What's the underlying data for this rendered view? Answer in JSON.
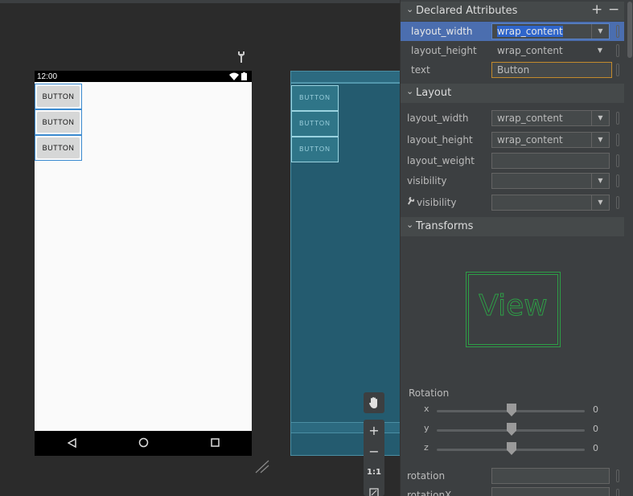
{
  "phone": {
    "time": "12:00",
    "buttons": [
      "BUTTON",
      "BUTTON",
      "BUTTON"
    ]
  },
  "blueprint": {
    "buttons": [
      "BUTTON",
      "BUTTON",
      "BUTTON"
    ]
  },
  "zoom_tools": {
    "pan_icon": "hand-icon",
    "zoom_in": "+",
    "zoom_out": "−",
    "actual_size": "1:1",
    "fit_icon": "fit-screen-icon"
  },
  "declared": {
    "title": "Declared Attributes",
    "add": "+",
    "remove": "−",
    "rows": [
      {
        "label": "layout_width",
        "value": "wrap_content"
      },
      {
        "label": "layout_height",
        "value": "wrap_content"
      },
      {
        "label": "text",
        "value": "Button"
      }
    ]
  },
  "layout": {
    "title": "Layout",
    "rows": [
      {
        "label": "layout_width",
        "value": "wrap_content"
      },
      {
        "label": "layout_height",
        "value": "wrap_content"
      },
      {
        "label": "layout_weight",
        "value": ""
      },
      {
        "label": "visibility",
        "value": ""
      },
      {
        "label": "visibility",
        "value": ""
      }
    ]
  },
  "transforms": {
    "title": "Transforms",
    "preview_text": "View",
    "rotation_label": "Rotation",
    "axes": [
      {
        "axis": "x",
        "value": "0"
      },
      {
        "axis": "y",
        "value": "0"
      },
      {
        "axis": "z",
        "value": "0"
      }
    ],
    "rows": [
      {
        "label": "rotation",
        "value": ""
      },
      {
        "label": "rotationX",
        "value": ""
      }
    ]
  },
  "colors": {
    "selected_row": "#4b6eaf",
    "blueprint_bg": "#245b6f",
    "view_preview": "#2e9e47",
    "text_field_border": "#c28a2c"
  }
}
